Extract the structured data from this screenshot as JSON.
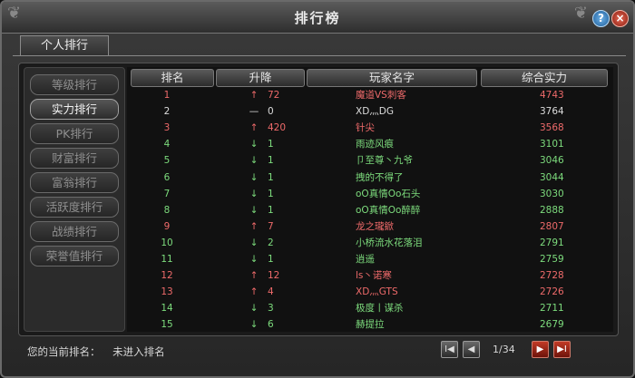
{
  "window": {
    "title": "排行榜",
    "help_label": "?",
    "close_label": "×"
  },
  "tab": {
    "label": "个人排行"
  },
  "sidebar": {
    "items": [
      {
        "label": "等级排行"
      },
      {
        "label": "实力排行"
      },
      {
        "label": "PK排行"
      },
      {
        "label": "财富排行"
      },
      {
        "label": "富翁排行"
      },
      {
        "label": "活跃度排行"
      },
      {
        "label": "战绩排行"
      },
      {
        "label": "荣誉值排行"
      }
    ],
    "active_index": 1
  },
  "table": {
    "headers": {
      "rank": "排名",
      "change": "升降",
      "name": "玩家名字",
      "power": "综合实力"
    },
    "rows": [
      {
        "rank": "1",
        "arrow": "↑",
        "change": "72",
        "name": "魔道VS刺客",
        "power": "4743",
        "color": "red"
      },
      {
        "rank": "2",
        "arrow": "—",
        "change": "0",
        "name": "XD灬DG",
        "power": "3764",
        "color": "white"
      },
      {
        "rank": "3",
        "arrow": "↑",
        "change": "420",
        "name": "针尖",
        "power": "3568",
        "color": "red"
      },
      {
        "rank": "4",
        "arrow": "↓",
        "change": "1",
        "name": "雨迹风痕",
        "power": "3101",
        "color": "green"
      },
      {
        "rank": "5",
        "arrow": "↓",
        "change": "1",
        "name": "卩至尊丶九爷",
        "power": "3046",
        "color": "green"
      },
      {
        "rank": "6",
        "arrow": "↓",
        "change": "1",
        "name": "拽的不得了",
        "power": "3044",
        "color": "green"
      },
      {
        "rank": "7",
        "arrow": "↓",
        "change": "1",
        "name": "oO真情Oo石头",
        "power": "3030",
        "color": "green"
      },
      {
        "rank": "8",
        "arrow": "↓",
        "change": "1",
        "name": "oO真情Oo醉醉",
        "power": "2888",
        "color": "green"
      },
      {
        "rank": "9",
        "arrow": "↑",
        "change": "7",
        "name": "龙之瓏鍁",
        "power": "2807",
        "color": "red"
      },
      {
        "rank": "10",
        "arrow": "↓",
        "change": "2",
        "name": "小桥流水花落泪",
        "power": "2791",
        "color": "green"
      },
      {
        "rank": "11",
        "arrow": "↓",
        "change": "1",
        "name": "逍遥",
        "power": "2759",
        "color": "green"
      },
      {
        "rank": "12",
        "arrow": "↑",
        "change": "12",
        "name": "ls丶诺寒",
        "power": "2728",
        "color": "red"
      },
      {
        "rank": "13",
        "arrow": "↑",
        "change": "4",
        "name": "XD灬GTS",
        "power": "2726",
        "color": "red"
      },
      {
        "rank": "14",
        "arrow": "↓",
        "change": "3",
        "name": "极度丨谋杀",
        "power": "2711",
        "color": "green"
      },
      {
        "rank": "15",
        "arrow": "↓",
        "change": "6",
        "name": "赫提拉",
        "power": "2679",
        "color": "green"
      }
    ]
  },
  "status": {
    "label": "您的当前排名：",
    "value": "未进入排名"
  },
  "pagination": {
    "page_info": "1/34",
    "first": "I◀",
    "prev": "◀",
    "next": "▶",
    "last": "▶I"
  }
}
